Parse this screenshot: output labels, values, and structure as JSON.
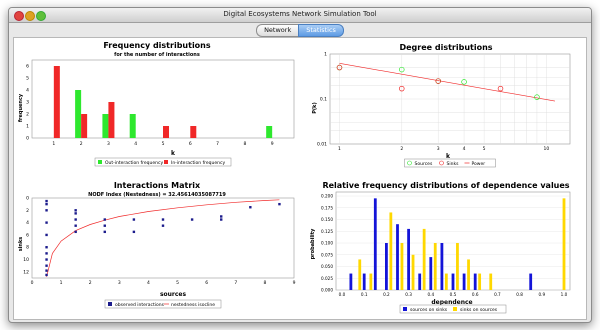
{
  "window": {
    "title": "Digital Ecosystems Network Simulation Tool"
  },
  "tabs": [
    {
      "label": "Network",
      "active": false
    },
    {
      "label": "Statistics",
      "active": true
    }
  ],
  "colors": {
    "green": "#2ee82e",
    "red": "#f02828",
    "navy": "#1c1c8c",
    "blue": "#1414d8",
    "gold": "#ffd800",
    "tab_active": "#5d9be4"
  },
  "icons": {
    "close": "close-icon",
    "minimize": "minimize-icon",
    "maximize": "maximize-icon"
  },
  "chart_data": [
    {
      "id": "frequency",
      "type": "bar",
      "title": "Frequency distributions",
      "subtitle": "for the number of interactions",
      "xlabel": "k",
      "ylabel": "frequency",
      "categories": [
        "1",
        "2",
        "3",
        "4",
        "5",
        "6",
        "7",
        "8",
        "9"
      ],
      "ylim": [
        0,
        6
      ],
      "yticks": [
        "0",
        "1",
        "2",
        "3",
        "4",
        "5",
        "6"
      ],
      "series": [
        {
          "name": "Out-interaction frequency",
          "values": [
            0,
            4,
            2,
            2,
            0,
            0,
            0,
            0,
            1
          ]
        },
        {
          "name": "In-interaction frequency",
          "values": [
            6,
            2,
            3,
            0,
            1,
            1,
            0,
            0,
            0
          ]
        }
      ],
      "legend": "bottom"
    },
    {
      "id": "degree",
      "type": "scatter",
      "title": "Degree distributions",
      "xlabel": "k",
      "ylabel": "P(k)",
      "xscale": "log",
      "yscale": "log",
      "xlim": [
        0.9,
        13
      ],
      "ylim": [
        0.01,
        1
      ],
      "xticks": [
        "1",
        "2",
        "3",
        "4",
        "5",
        "10"
      ],
      "yticks": [
        "1",
        "0.1",
        "0.01"
      ],
      "series": [
        {
          "name": "Sources",
          "points": [
            [
              1,
              0.5
            ],
            [
              2,
              0.45
            ],
            [
              3,
              0.25
            ],
            [
              4,
              0.24
            ],
            [
              9,
              0.11
            ]
          ]
        },
        {
          "name": "Sinks",
          "points": [
            [
              1,
              0.5
            ],
            [
              2,
              0.17
            ],
            [
              3,
              0.25
            ],
            [
              6,
              0.17
            ]
          ]
        },
        {
          "name": "Power",
          "points": [
            [
              1,
              0.62
            ],
            [
              11,
              0.09
            ]
          ]
        }
      ],
      "legend": "bottom"
    },
    {
      "id": "matrix",
      "type": "scatter",
      "title": "Interactions Matrix",
      "subtitle": "NODF Index (Nestedness) = 32.45614035087719",
      "xlabel": "sources",
      "ylabel": "sinks",
      "xlim": [
        0,
        9
      ],
      "ylim": [
        0,
        13
      ],
      "xticks": [
        "0",
        "1",
        "2",
        "3",
        "4",
        "5",
        "6",
        "7",
        "8",
        "9"
      ],
      "yticks": [
        "0",
        "2",
        "4",
        "6",
        "8",
        "10",
        "12"
      ],
      "series": [
        {
          "name": "observed interactions",
          "points": [
            [
              0.5,
              0.5
            ],
            [
              0.5,
              1
            ],
            [
              0.5,
              2
            ],
            [
              0.5,
              4
            ],
            [
              0.5,
              6
            ],
            [
              0.5,
              8
            ],
            [
              0.5,
              9
            ],
            [
              0.5,
              10
            ],
            [
              0.5,
              11
            ],
            [
              0.5,
              11.8
            ],
            [
              0.5,
              12.5
            ],
            [
              1.5,
              2
            ],
            [
              1.5,
              2.5
            ],
            [
              1.5,
              3.5
            ],
            [
              1.5,
              4.5
            ],
            [
              1.5,
              5.5
            ],
            [
              2.5,
              3.5
            ],
            [
              2.5,
              4.5
            ],
            [
              2.5,
              5.5
            ],
            [
              3.5,
              3.5
            ],
            [
              3.5,
              5.5
            ],
            [
              4.5,
              3.5
            ],
            [
              4.5,
              4.5
            ],
            [
              5.5,
              3.5
            ],
            [
              6.5,
              3
            ],
            [
              6.5,
              3.5
            ],
            [
              7.5,
              1.5
            ],
            [
              8.5,
              1
            ]
          ]
        },
        {
          "name": "nestedness isocline",
          "points": [
            [
              0.5,
              12.8
            ],
            [
              0.7,
              9
            ],
            [
              1,
              7
            ],
            [
              1.5,
              5.3
            ],
            [
              2,
              4.3
            ],
            [
              2.5,
              3.6
            ],
            [
              3,
              3
            ],
            [
              4,
              2.2
            ],
            [
              5,
              1.6
            ],
            [
              6,
              1.1
            ],
            [
              7,
              0.7
            ],
            [
              8,
              0.4
            ],
            [
              8.5,
              0.3
            ]
          ]
        }
      ],
      "legend": "bottom"
    },
    {
      "id": "dependence",
      "type": "bar",
      "title": "Relative frequency distributions of dependence values",
      "xlabel": "dependence",
      "ylabel": "probability",
      "xlim": [
        0,
        1
      ],
      "ylim": [
        0,
        0.2
      ],
      "xticks": [
        "0.0",
        "0.1",
        "0.2",
        "0.3",
        "0.4",
        "0.5",
        "0.6",
        "0.7",
        "0.8",
        "0.9",
        "1.0"
      ],
      "yticks": [
        "0.000",
        "0.025",
        "0.050",
        "0.075",
        "0.100",
        "0.125",
        "0.150",
        "0.175",
        "0.200"
      ],
      "series": [
        {
          "name": "sources on sinks",
          "x": [
            0.04,
            0.1,
            0.15,
            0.2,
            0.25,
            0.3,
            0.35,
            0.4,
            0.45,
            0.5,
            0.55,
            0.6,
            0.85
          ],
          "values": [
            0.035,
            0.035,
            0.195,
            0.1,
            0.14,
            0.13,
            0.035,
            0.07,
            0.1,
            0.035,
            0.035,
            0.035,
            0.035
          ]
        },
        {
          "name": "sinks on sources",
          "x": [
            0.08,
            0.13,
            0.22,
            0.27,
            0.32,
            0.37,
            0.42,
            0.47,
            0.52,
            0.57,
            0.62,
            0.67,
            1.0
          ],
          "values": [
            0.065,
            0.035,
            0.165,
            0.1,
            0.075,
            0.13,
            0.1,
            0.035,
            0.1,
            0.065,
            0.035,
            0.035,
            0.195
          ]
        }
      ],
      "legend": "bottom"
    }
  ]
}
